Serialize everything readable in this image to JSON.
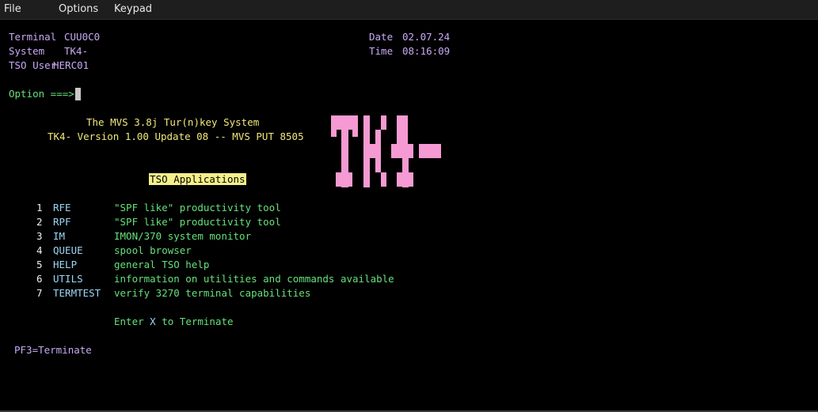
{
  "menu": {
    "file": "File",
    "options": "Options",
    "keypad": "Keypad"
  },
  "header": {
    "terminal_label": "Terminal",
    "terminal_value": "CUU0C0",
    "system_label": "System",
    "system_value": "TK4-",
    "user_label": "TSO User",
    "user_value": "HERC01",
    "date_label": "Date",
    "date_value": "02.07.24",
    "time_label": "Time",
    "time_value": "08:16:09"
  },
  "option": {
    "prompt": "Option ===>",
    "value": ""
  },
  "banner": {
    "line1": "The MVS 3.8j Tur(n)key System",
    "line2": "TK4- Version 1.00 Update 08 -- MVS PUT 8505",
    "section": "TSO Applications",
    "logo_color": "#f59ad2"
  },
  "apps": [
    {
      "num": "1",
      "name": "RFE",
      "desc": "\"SPF like\" productivity tool"
    },
    {
      "num": "2",
      "name": "RPF",
      "desc": "\"SPF like\" productivity tool"
    },
    {
      "num": "3",
      "name": "IM",
      "desc": "IMON/370 system monitor"
    },
    {
      "num": "4",
      "name": "QUEUE",
      "desc": "spool browser"
    },
    {
      "num": "5",
      "name": "HELP",
      "desc": "general TSO help"
    },
    {
      "num": "6",
      "name": "UTILS",
      "desc": "information on utilities and commands available"
    },
    {
      "num": "7",
      "name": "TERMTEST",
      "desc": "verify 3270 terminal capabilities"
    }
  ],
  "footer": {
    "terminate_pre": "Enter ",
    "terminate_key": "X",
    "terminate_post": " to Terminate",
    "pf3": "PF3=Terminate"
  },
  "colors": {
    "background": "#000000",
    "label": "#c9a9f5",
    "green": "#66e07a",
    "yellow": "#f2e77a",
    "cyan": "#9cd7f7",
    "logo": "#f59ad2"
  }
}
